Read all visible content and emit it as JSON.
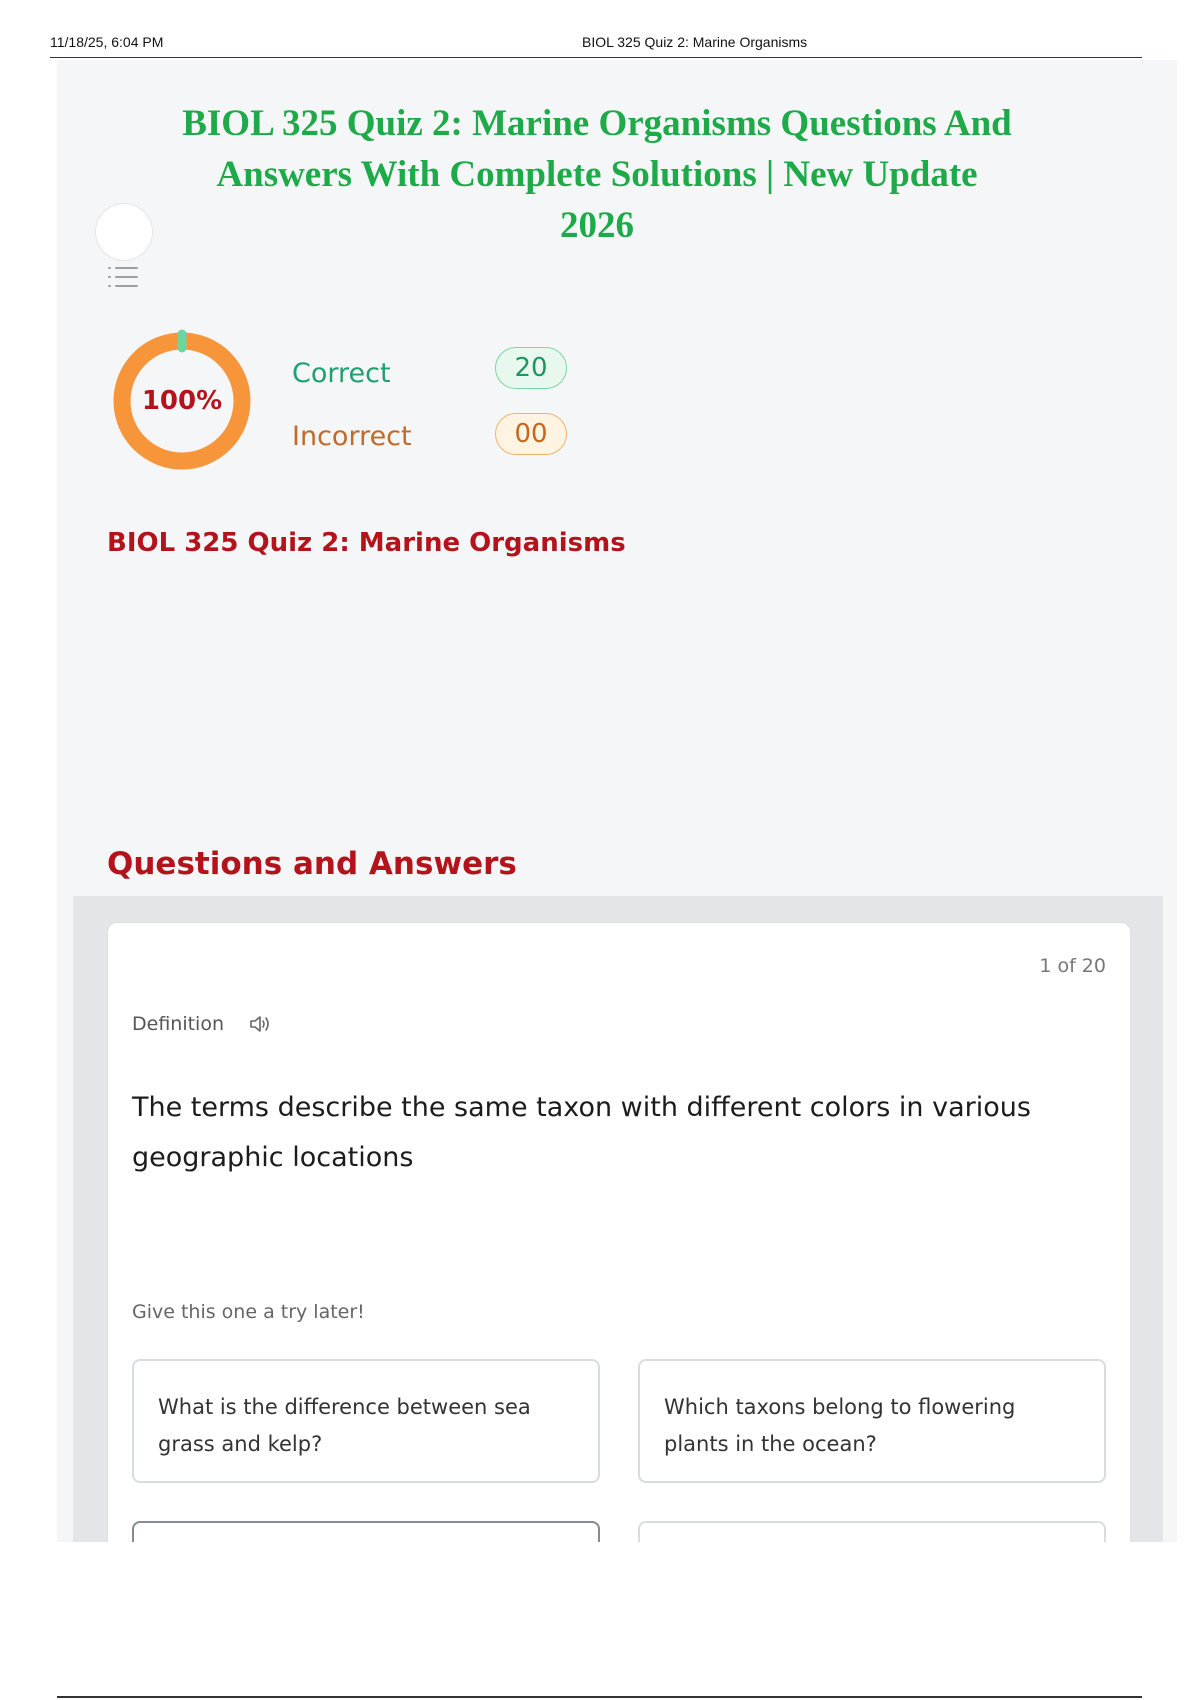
{
  "print_header": {
    "datetime": "11/18/25, 6:04 PM",
    "title": "BIOL 325 Quiz 2: Marine Organisms"
  },
  "document": {
    "title_lines": [
      "BIOL 325 Quiz 2: Marine Organisms Questions And",
      "Answers With Complete Solutions | New Update",
      "2026"
    ]
  },
  "score": {
    "percent_label": "100%",
    "percent_value": 100,
    "correct_label": "Correct",
    "correct_count": "20",
    "incorrect_label": "Incorrect",
    "incorrect_count": "00"
  },
  "quiz_subtitle": "BIOL 325 Quiz 2: Marine Organisms",
  "qa_heading": "Questions and Answers",
  "flashcard": {
    "counter": "1 of 20",
    "type_label": "Definition",
    "definition": "The terms describe the same taxon with different colors in various geographic locations",
    "hint": "Give this one a try later!",
    "options": [
      "What is the difference between sea grass and kelp?",
      "Which taxons belong to flowering plants in the ocean?",
      "",
      ""
    ]
  },
  "colors": {
    "title_green": "#1eaa48",
    "heading_red": "#b3141b",
    "donut_orange": "#f7953a",
    "donut_green": "#6bd6a0"
  },
  "icons": [
    "list-icon",
    "speaker-icon"
  ]
}
